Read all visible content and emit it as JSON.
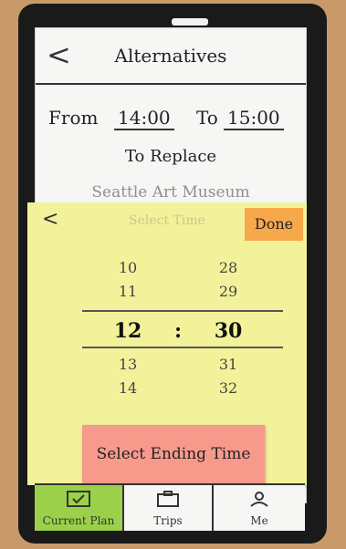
{
  "header": {
    "back_label": "<",
    "title": "Alternatives"
  },
  "form": {
    "from_label": "From",
    "from_value": "14:00",
    "to_label": "To",
    "to_value": "15:00",
    "to_replace": "To Replace",
    "place": "Seattle Art Museum"
  },
  "overlay": {
    "back_label": "<",
    "faded_title": "Select Time",
    "done_label": "Done",
    "picker": {
      "rows": [
        {
          "hour": "10",
          "minute": "28"
        },
        {
          "hour": "11",
          "minute": "29"
        },
        {
          "hour": "12",
          "minute": "30",
          "selected": true
        },
        {
          "hour": "13",
          "minute": "31"
        },
        {
          "hour": "14",
          "minute": "32"
        }
      ],
      "colon": ":"
    },
    "hint": "Select Ending Time"
  },
  "tabs": [
    {
      "label": "Current Plan",
      "icon": "check-icon",
      "active": true
    },
    {
      "label": "Trips",
      "icon": "suitcase-icon",
      "active": false
    },
    {
      "label": "Me",
      "icon": "person-icon",
      "active": false
    }
  ]
}
